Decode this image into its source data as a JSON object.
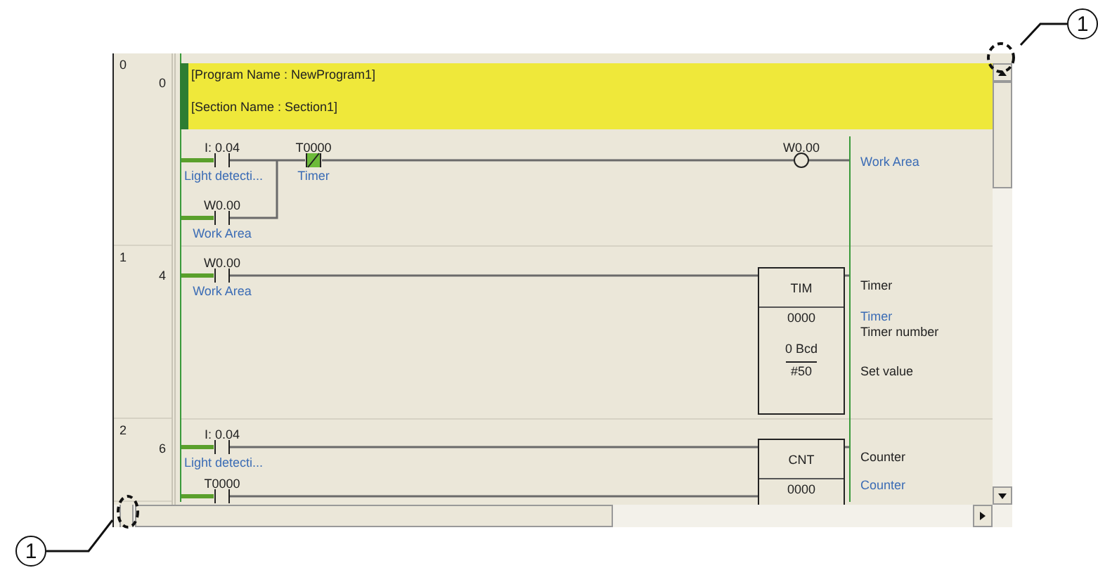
{
  "header": {
    "program_name": "[Program Name : NewProgram1]",
    "section_name": "[Section Name : Section1]"
  },
  "rows": [
    {
      "step": "0",
      "address": "0"
    },
    {
      "step": "1",
      "address": "4"
    },
    {
      "step": "2",
      "address": "6"
    }
  ],
  "rungs": [
    {
      "contacts": [
        {
          "kind": "no",
          "operand": "I: 0.04",
          "comment": "Light detecti..."
        },
        {
          "kind": "nc",
          "operand": "T0000",
          "comment": "Timer"
        },
        {
          "kind": "no",
          "operand": "W0.00",
          "comment": "Work Area"
        }
      ],
      "coil": {
        "operand": "W0.00",
        "comment": "Work Area"
      }
    },
    {
      "contacts": [
        {
          "kind": "no",
          "operand": "W0.00",
          "comment": "Work Area"
        }
      ],
      "instruction": {
        "mnemonic": "TIM",
        "operand": "0000",
        "setting": "0 Bcd",
        "value": "#50"
      },
      "notes": [
        {
          "kind": "title",
          "text": "Timer"
        },
        {
          "kind": "comment",
          "text": "Timer"
        },
        {
          "kind": "label",
          "text": "Timer number"
        },
        {
          "kind": "label",
          "text": "Set value"
        }
      ]
    },
    {
      "contacts": [
        {
          "kind": "no",
          "operand": "I: 0.04",
          "comment": "Light detecti..."
        },
        {
          "kind": "no",
          "operand": "T0000"
        }
      ],
      "instruction": {
        "mnemonic": "CNT",
        "operand": "0000"
      },
      "notes": [
        {
          "kind": "title",
          "text": "Counter"
        },
        {
          "kind": "comment",
          "text": "Counter"
        }
      ]
    }
  ],
  "callouts": [
    {
      "label": "1"
    },
    {
      "label": "1"
    }
  ]
}
